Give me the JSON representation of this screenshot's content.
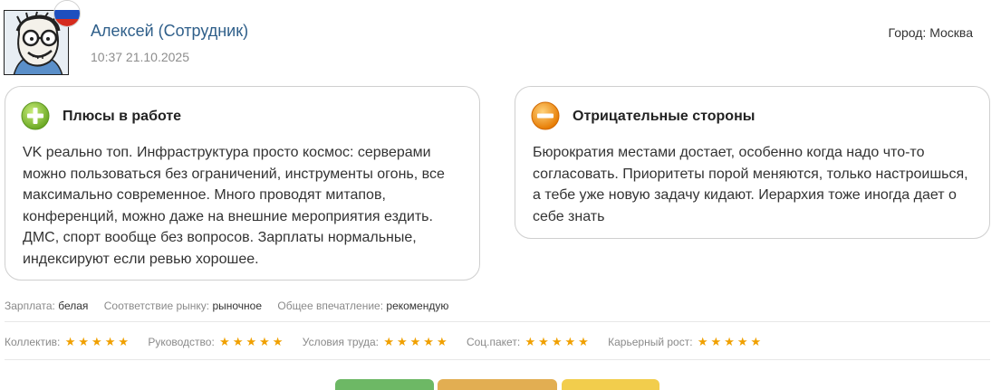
{
  "review": {
    "author": "Алексей (Сотрудник)",
    "datetime": "10:37 21.10.2025",
    "city_label": "Город:",
    "city_value": "Москва",
    "flag_colors": [
      "#ffffff",
      "#1e4fbf",
      "#d52b1e"
    ]
  },
  "pros": {
    "title": "Плюсы в работе",
    "text": "VK реально топ. Инфраструктура просто космос: серверами можно пользоваться без ограничений, инструменты огонь, все максимально современное. Много проводят митапов, конференций, можно даже на внешние мероприятия ездить. ДМС, спорт вообще без вопросов. Зарплаты нормальные, индексируют если ревью хорошее.",
    "icon": "plus-circle-icon",
    "icon_color": "#7cbb2f"
  },
  "cons": {
    "title": "Отрицательные стороны",
    "text": "Бюрократия местами достает, особенно когда надо что-то согласовать. Приоритеты порой меняются, только настроишься, а тебе уже новую задачу кидают. Иерархия тоже иногда дает о себе знать",
    "icon": "minus-circle-icon",
    "icon_color": "#f08a00"
  },
  "meta": [
    {
      "label": "Зарплата:",
      "value": "белая"
    },
    {
      "label": "Соответствие рынку:",
      "value": "рыночное"
    },
    {
      "label": "Общее впечатление:",
      "value": "рекомендую"
    }
  ],
  "ratings": [
    {
      "label": "Коллектив:",
      "stars": 5
    },
    {
      "label": "Руководство:",
      "stars": 5
    },
    {
      "label": "Условия труда:",
      "stars": 5
    },
    {
      "label": "Соц.пакет:",
      "stars": 5
    },
    {
      "label": "Карьерный рост:",
      "stars": 5
    }
  ],
  "star_color": "#f0a000",
  "buttons": [
    {
      "color": "#6db865"
    },
    {
      "color": "#e2ae52"
    },
    {
      "color": "#f2cd4c"
    }
  ]
}
